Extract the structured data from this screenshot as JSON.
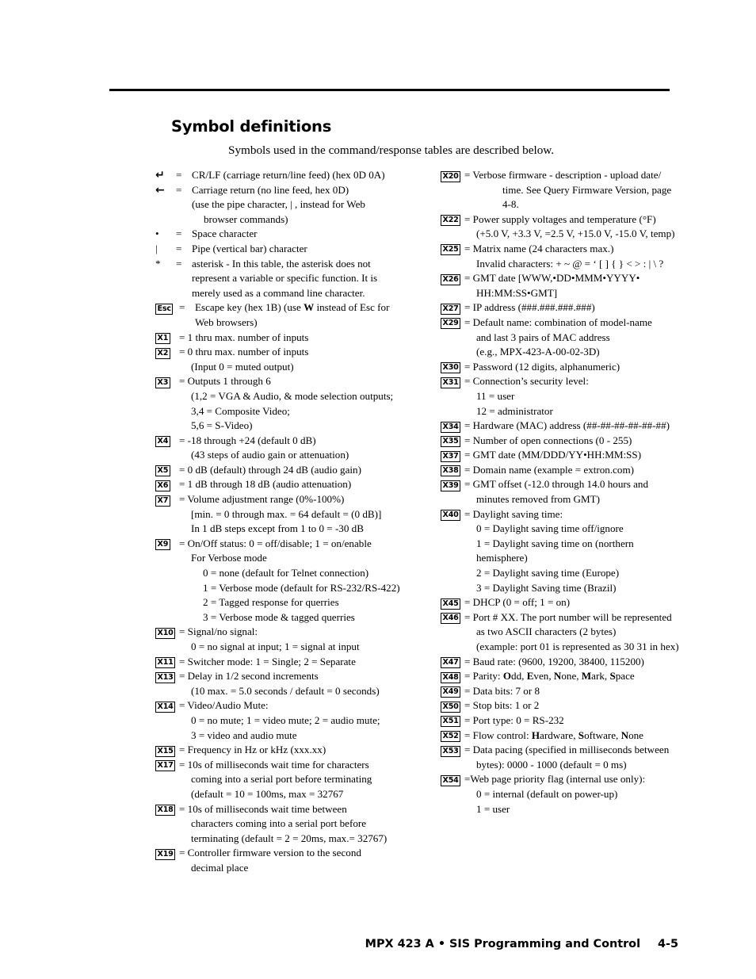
{
  "document": {
    "heading": "Symbol definitions",
    "subheading": "Symbols used in the command/response tables are described below.",
    "footer_title": "MPX 423 A • SIS Programming and Control",
    "footer_page": "4-5"
  },
  "left_column": [
    {
      "marker_type": "glyph",
      "marker": "↵",
      "eq": "=",
      "lines": [
        {
          "text": "CR/LF (carriage return/line feed) (hex 0D 0A)",
          "indent": 0
        }
      ]
    },
    {
      "marker_type": "glyph",
      "marker": "←",
      "eq": "=",
      "lines": [
        {
          "text": "Carriage return (no line feed, hex 0D)",
          "indent": 0
        },
        {
          "text": "(use the pipe character,  |  , instead for Web",
          "indent": 0
        },
        {
          "text": "browser commands)",
          "indent": 1
        }
      ]
    },
    {
      "marker_type": "glyph-serif",
      "marker": "•",
      "eq": "=",
      "lines": [
        {
          "text": "Space character",
          "indent": 0
        }
      ]
    },
    {
      "marker_type": "glyph-serif",
      "marker": "|",
      "eq": "=",
      "lines": [
        {
          "text": "Pipe (vertical bar) character",
          "indent": 0
        }
      ]
    },
    {
      "marker_type": "glyph-serif",
      "marker": "*",
      "eq": "=",
      "lines": [
        {
          "text": "asterisk - In this table, the asterisk does not",
          "indent": 0
        },
        {
          "text": "represent a variable or specific function.  It is",
          "indent": 0
        },
        {
          "text": "merely used as a command line character.",
          "indent": 0
        }
      ]
    },
    {
      "marker_type": "keybox",
      "marker": "Esc",
      "eq": "=",
      "lines": [
        {
          "text": "Escape key (hex 1B) (use W instead of Esc for",
          "indent": 0,
          "bold_at": "W"
        },
        {
          "text": "Web browsers)",
          "indent": 0
        }
      ]
    },
    {
      "marker_type": "keybox",
      "marker": "X1",
      "eq": "",
      "lines": [
        {
          "text": "= 1 thru max. number of inputs",
          "indent": 0
        }
      ]
    },
    {
      "marker_type": "keybox",
      "marker": "X2",
      "eq": "",
      "lines": [
        {
          "text": "= 0 thru max. number of inputs",
          "indent": 0
        },
        {
          "text": "(Input 0 = muted output)",
          "indent": 1
        }
      ]
    },
    {
      "marker_type": "keybox",
      "marker": "X3",
      "eq": "",
      "lines": [
        {
          "text": "= Outputs 1 through 6",
          "indent": 0
        },
        {
          "text": "(1,2 = VGA & Audio, & mode selection outputs;",
          "indent": 1
        },
        {
          "text": "3,4 = Composite Video;",
          "indent": 1
        },
        {
          "text": "5,6 = S-Video)",
          "indent": 1
        }
      ]
    },
    {
      "marker_type": "keybox",
      "marker": "X4",
      "eq": "",
      "lines": [
        {
          "text": "= -18 through +24 (default 0 dB)",
          "indent": 0
        },
        {
          "text": "(43 steps of audio gain or attenuation)",
          "indent": 1
        }
      ]
    },
    {
      "marker_type": "keybox",
      "marker": "X5",
      "eq": "",
      "lines": [
        {
          "text": "= 0 dB (default) through 24 dB (audio gain)",
          "indent": 0
        }
      ]
    },
    {
      "marker_type": "keybox",
      "marker": "X6",
      "eq": "",
      "lines": [
        {
          "text": "= 1 dB through 18 dB (audio attenuation)",
          "indent": 0
        }
      ]
    },
    {
      "marker_type": "keybox",
      "marker": "X7",
      "eq": "",
      "lines": [
        {
          "text": "= Volume adjustment range (0%-100%)",
          "indent": 0
        },
        {
          "text": "[min. = 0 through max. = 64 default = (0 dB)]",
          "indent": 1
        },
        {
          "text": "In 1 dB steps except from 1 to 0 = -30 dB",
          "indent": 1
        }
      ]
    },
    {
      "marker_type": "keybox",
      "marker": "X9",
      "eq": "",
      "lines": [
        {
          "text": "= On/Off status: 0 = off/disable;  1 = on/enable",
          "indent": 0
        },
        {
          "text": "For Verbose mode",
          "indent": 1
        },
        {
          "text": "0 = none (default for Telnet connection)",
          "indent": 2
        },
        {
          "text": "1 = Verbose mode (default for RS-232/RS-422)",
          "indent": 2
        },
        {
          "text": "2 = Tagged response for querries",
          "indent": 2
        },
        {
          "text": "3 = Verbose mode & tagged querries",
          "indent": 2
        }
      ]
    },
    {
      "marker_type": "keybox",
      "marker": "X10",
      "eq": "",
      "lines": [
        {
          "text": "= Signal/no signal:",
          "indent": 0
        },
        {
          "text": "0 = no signal at input;  1 = signal at input",
          "indent": 1
        }
      ]
    },
    {
      "marker_type": "keybox",
      "marker": "X11",
      "eq": "",
      "lines": [
        {
          "text": "= Switcher mode: 1 = Single;  2 = Separate",
          "indent": 0
        }
      ]
    },
    {
      "marker_type": "keybox",
      "marker": "X13",
      "eq": "",
      "lines": [
        {
          "text": "= Delay in 1/2 second increments",
          "indent": 0
        },
        {
          "text": "(10 max. = 5.0 seconds / default = 0 seconds)",
          "indent": 1
        }
      ]
    },
    {
      "marker_type": "keybox",
      "marker": "X14",
      "eq": "",
      "lines": [
        {
          "text": "= Video/Audio Mute:",
          "indent": 0
        },
        {
          "text": "0 = no mute;  1 = video mute;  2 = audio mute;",
          "indent": 1
        },
        {
          "text": "3 = video and audio mute",
          "indent": 1
        }
      ]
    },
    {
      "marker_type": "keybox",
      "marker": "X15",
      "eq": "",
      "lines": [
        {
          "text": "= Frequency in Hz or kHz (xxx.xx)",
          "indent": 0
        }
      ]
    },
    {
      "marker_type": "keybox",
      "marker": "X17",
      "eq": "",
      "lines": [
        {
          "text": "= 10s of milliseconds wait time for characters",
          "indent": 0
        },
        {
          "text": "coming into a serial port before terminating",
          "indent": 1
        },
        {
          "text": "(default = 10 = 100ms, max = 32767",
          "indent": 1
        }
      ]
    },
    {
      "marker_type": "keybox",
      "marker": "X18",
      "eq": "",
      "lines": [
        {
          "text": "= 10s of milliseconds wait time between",
          "indent": 0
        },
        {
          "text": "characters coming into a serial port before",
          "indent": 1
        },
        {
          "text": "terminating (default = 2 = 20ms, max.= 32767)",
          "indent": 1
        }
      ]
    },
    {
      "marker_type": "keybox",
      "marker": "X19",
      "eq": "",
      "lines": [
        {
          "text": "= Controller firmware version to the second",
          "indent": 0
        },
        {
          "text": "decimal place",
          "indent": 1
        }
      ]
    }
  ],
  "right_column": [
    {
      "marker_type": "keybox",
      "marker": "X20",
      "eq": "",
      "lines": [
        {
          "text": "= Verbose firmware - description - upload date/",
          "indent": 0
        },
        {
          "text": "time.  See Query Firmware Version, page",
          "indent": 3
        },
        {
          "text": "4-8.",
          "indent": 3
        }
      ]
    },
    {
      "marker_type": "keybox",
      "marker": "X22",
      "eq": "",
      "lines": [
        {
          "text": "= Power supply voltages and temperature (°F)",
          "indent": 0
        },
        {
          "text": "(+5.0 V, +3.3 V, =2.5 V, +15.0 V, -15.0 V, temp)",
          "indent": 1
        }
      ]
    },
    {
      "marker_type": "keybox",
      "marker": "X25",
      "eq": "",
      "lines": [
        {
          "text": "= Matrix name (24 characters max.)",
          "indent": 0
        },
        {
          "text": "Invalid characters:  + ~ @ = ‘ [ ] { } < > : | \\ ?",
          "indent": 1
        }
      ]
    },
    {
      "marker_type": "keybox",
      "marker": "X26",
      "eq": "",
      "lines": [
        {
          "text": "= GMT date [WWW,•DD•MMM•YYYY•",
          "indent": 0
        },
        {
          "text": "HH:MM:SS•GMT]",
          "indent": 1
        }
      ]
    },
    {
      "marker_type": "keybox",
      "marker": "X27",
      "eq": "",
      "lines": [
        {
          "text": "= IP address (###.###.###.###)",
          "indent": 0
        }
      ]
    },
    {
      "marker_type": "keybox",
      "marker": "X29",
      "eq": "",
      "lines": [
        {
          "text": "= Default name: combination of model-name",
          "indent": 0
        },
        {
          "text": "and last 3 pairs of MAC address",
          "indent": 1
        },
        {
          "text": "(e.g., MPX-423-A-00-02-3D)",
          "indent": 1
        }
      ]
    },
    {
      "marker_type": "keybox",
      "marker": "X30",
      "eq": "",
      "lines": [
        {
          "text": "= Password (12 digits, alphanumeric)",
          "indent": 0
        }
      ]
    },
    {
      "marker_type": "keybox",
      "marker": "X31",
      "eq": "",
      "lines": [
        {
          "text": "= Connection’s security level:",
          "indent": 0
        },
        {
          "text": "11 = user",
          "indent": 1
        },
        {
          "text": "12 = administrator",
          "indent": 1
        }
      ]
    },
    {
      "marker_type": "keybox",
      "marker": "X34",
      "eq": "",
      "lines": [
        {
          "text": "= Hardware (MAC) address (##-##-##-##-##-##)",
          "indent": 0
        }
      ]
    },
    {
      "marker_type": "keybox",
      "marker": "X35",
      "eq": "",
      "lines": [
        {
          "text": "= Number of open connections (0 - 255)",
          "indent": 0
        }
      ]
    },
    {
      "marker_type": "keybox",
      "marker": "X37",
      "eq": "",
      "lines": [
        {
          "text": "= GMT date (MM/DDD/YY•HH:MM:SS)",
          "indent": 0
        }
      ]
    },
    {
      "marker_type": "keybox",
      "marker": "X38",
      "eq": "",
      "lines": [
        {
          "text": "= Domain name (example = extron.com)",
          "indent": 0
        }
      ]
    },
    {
      "marker_type": "keybox",
      "marker": "X39",
      "eq": "",
      "lines": [
        {
          "text": "= GMT offset (-12.0 through 14.0 hours and",
          "indent": 0
        },
        {
          "text": "minutes removed from GMT)",
          "indent": 1
        }
      ]
    },
    {
      "marker_type": "keybox",
      "marker": "X40",
      "eq": "",
      "lines": [
        {
          "text": "= Daylight saving time:",
          "indent": 0
        },
        {
          "text": "0 = Daylight saving time off/ignore",
          "indent": 1
        },
        {
          "text": "1 = Daylight saving time on (northern",
          "indent": 1
        },
        {
          "text": "hemisphere)",
          "indent": 1
        },
        {
          "text": "2 = Daylight saving time (Europe)",
          "indent": 1
        },
        {
          "text": "3 = Daylight Saving time (Brazil)",
          "indent": 1
        }
      ]
    },
    {
      "marker_type": "keybox",
      "marker": "X45",
      "eq": "",
      "lines": [
        {
          "text": "= DHCP (0 = off;  1 = on)",
          "indent": 0
        }
      ]
    },
    {
      "marker_type": "keybox",
      "marker": "X46",
      "eq": "",
      "lines": [
        {
          "text": "= Port # XX.  The port number will be represented",
          "indent": 0
        },
        {
          "text": "as two ASCII characters (2 bytes)",
          "indent": 1
        },
        {
          "text": "(example:  port 01 is represented as 30 31 in hex)",
          "indent": 1
        }
      ]
    },
    {
      "marker_type": "keybox",
      "marker": "X47",
      "eq": "",
      "lines": [
        {
          "text": "= Baud rate:  (9600, 19200, 38400, 115200)",
          "indent": 0
        }
      ]
    },
    {
      "marker_type": "keybox",
      "marker": "X48",
      "eq": "",
      "lines": [
        {
          "text": "= Parity:  Odd, Even, None, Mark, Space",
          "indent": 0
        }
      ]
    },
    {
      "marker_type": "keybox",
      "marker": "X49",
      "eq": "",
      "lines": [
        {
          "text": "= Data bits:  7 or 8",
          "indent": 0
        }
      ]
    },
    {
      "marker_type": "keybox",
      "marker": "X50",
      "eq": "",
      "lines": [
        {
          "text": "= Stop bits:  1 or 2",
          "indent": 0
        }
      ]
    },
    {
      "marker_type": "keybox",
      "marker": "X51",
      "eq": "",
      "lines": [
        {
          "text": "= Port type:  0 = RS-232",
          "indent": 0
        }
      ]
    },
    {
      "marker_type": "keybox",
      "marker": "X52",
      "eq": "",
      "lines": [
        {
          "text": "= Flow control:  Hardware, Software, None",
          "indent": 0
        }
      ]
    },
    {
      "marker_type": "keybox",
      "marker": "X53",
      "eq": "",
      "lines": [
        {
          "text": "= Data pacing (specified in milliseconds between",
          "indent": 0
        },
        {
          "text": "bytes): 0000 - 1000 (default =  0 ms)",
          "indent": 1
        }
      ]
    },
    {
      "marker_type": "keybox",
      "marker": "X54",
      "eq": "",
      "lines": [
        {
          "text": "=Web page priority flag (internal use only):",
          "indent": 0
        },
        {
          "text": "0 = internal (default on power-up)",
          "indent": 1
        },
        {
          "text": "1 = user",
          "indent": 1
        }
      ]
    }
  ]
}
